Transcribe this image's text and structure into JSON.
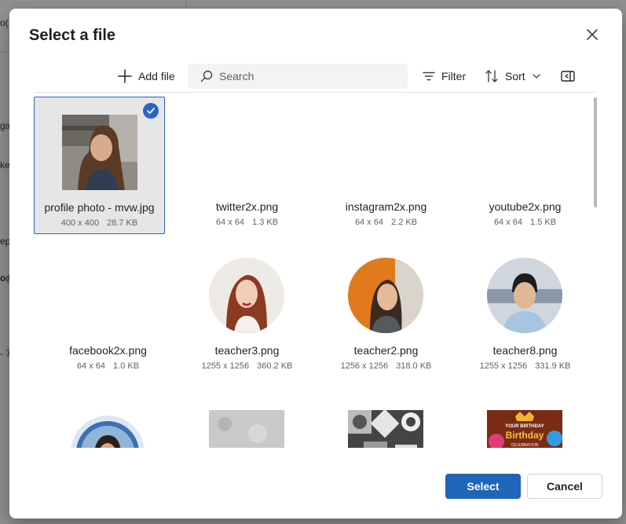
{
  "background_fragments": [
    "o(",
    "ga",
    "ke",
    "ep",
    "o@",
    "- 7"
  ],
  "dialog": {
    "title": "Select a file",
    "close_icon": "close-icon"
  },
  "toolbar": {
    "add_file_label": "Add file",
    "search_placeholder": "Search",
    "filter_label": "Filter",
    "sort_label": "Sort",
    "icons": [
      "add-icon",
      "search-icon",
      "filter-icon",
      "sort-icon",
      "chevron-down-icon",
      "panel-toggle-icon"
    ]
  },
  "files": [
    {
      "name": "profile photo - mvw.jpg",
      "dims": "400 x 400",
      "size": "28.7 KB",
      "selected": true
    },
    {
      "name": "twitter2x.png",
      "dims": "64 x 64",
      "size": "1.3 KB",
      "selected": false
    },
    {
      "name": "instagram2x.png",
      "dims": "64 x 64",
      "size": "2.2 KB",
      "selected": false
    },
    {
      "name": "youtube2x.png",
      "dims": "64 x 64",
      "size": "1.5 KB",
      "selected": false
    },
    {
      "name": "facebook2x.png",
      "dims": "64 x 64",
      "size": "1.0 KB",
      "selected": false
    },
    {
      "name": "teacher3.png",
      "dims": "1255 x 1256",
      "size": "360.2 KB",
      "selected": false
    },
    {
      "name": "teacher2.png",
      "dims": "1256 x 1256",
      "size": "318.0 KB",
      "selected": false
    },
    {
      "name": "teacher8.png",
      "dims": "1255 x 1256",
      "size": "331.9 KB",
      "selected": false
    }
  ],
  "thumbnail_texts": [
    "YOUR BIRTHDAY",
    "Birthday",
    "CELEBRATION"
  ],
  "footer": {
    "select_label": "Select",
    "cancel_label": "Cancel"
  },
  "colors": {
    "accent": "#1f66b8",
    "selection_border": "#2b63c7",
    "selection_bg": "#e6e6e6"
  }
}
